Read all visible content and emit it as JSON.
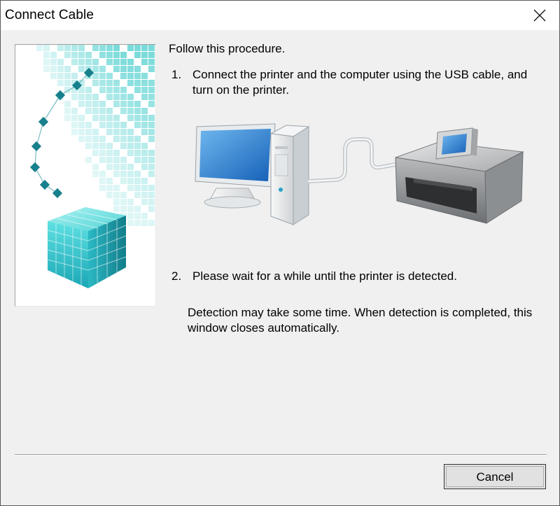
{
  "window": {
    "title": "Connect Cable",
    "close_icon": "close-icon"
  },
  "side_panel": {
    "image": "teal-cubes-graphic",
    "colors": {
      "accent": "#2cc4c8",
      "dark": "#1a8f99"
    }
  },
  "content": {
    "intro": "Follow this procedure.",
    "steps": [
      {
        "number": "1.",
        "text": "Connect the printer and the computer using the USB cable, and turn on the printer."
      },
      {
        "number": "2.",
        "text": "Please wait for a while until the printer is detected."
      }
    ],
    "detection_note": "Detection may take some time. When detection is completed, this window closes automatically.",
    "illustration": {
      "computer": "desktop-computer-icon",
      "cable": "usb-cable",
      "printer": "printer-icon"
    }
  },
  "footer": {
    "cancel_label": "Cancel"
  }
}
